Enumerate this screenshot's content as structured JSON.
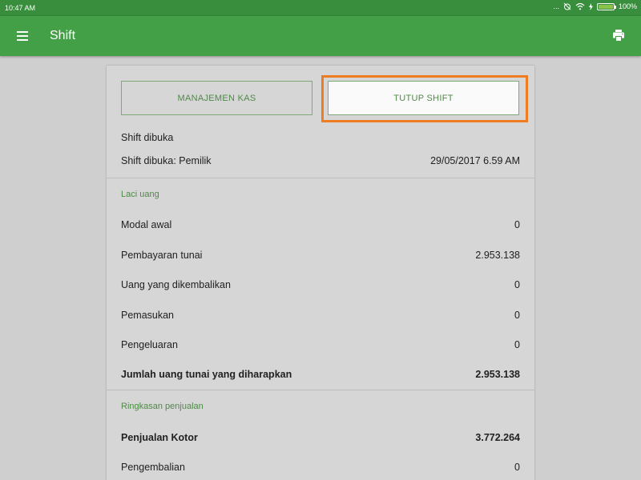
{
  "status_bar": {
    "time": "10:47 AM",
    "more": "...",
    "battery": "100%",
    "battery_level": 1.0
  },
  "app_bar": {
    "title": "Shift",
    "menu_icon": "hamburger-menu-icon",
    "print_icon": "printer-icon"
  },
  "actions": {
    "cash_management": "MANAJEMEN KAS",
    "close_shift": "TUTUP SHIFT"
  },
  "shift": {
    "opened_label": "Shift dibuka",
    "opened_by_label": "Shift dibuka: Pemilik",
    "opened_at": "29/05/2017 6.59 AM"
  },
  "cash_drawer": {
    "section_title": "Laci uang",
    "rows": [
      {
        "label": "Modal awal",
        "value": "0"
      },
      {
        "label": "Pembayaran tunai",
        "value": "2.953.138"
      },
      {
        "label": "Uang yang dikembalikan",
        "value": "0"
      },
      {
        "label": "Pemasukan",
        "value": "0"
      },
      {
        "label": "Pengeluaran",
        "value": "0"
      }
    ],
    "total": {
      "label": "Jumlah uang tunai yang diharapkan",
      "value": "2.953.138"
    }
  },
  "sales_summary": {
    "section_title": "Ringkasan penjualan",
    "rows": [
      {
        "label": "Penjualan Kotor",
        "value": "3.772.264"
      },
      {
        "label": "Pengembalian",
        "value": "0"
      }
    ]
  },
  "colors": {
    "status_bar": "#388e3c",
    "app_bar": "#43a047",
    "accent_green": "#4e8a46",
    "highlight_orange": "#ee7d22"
  }
}
